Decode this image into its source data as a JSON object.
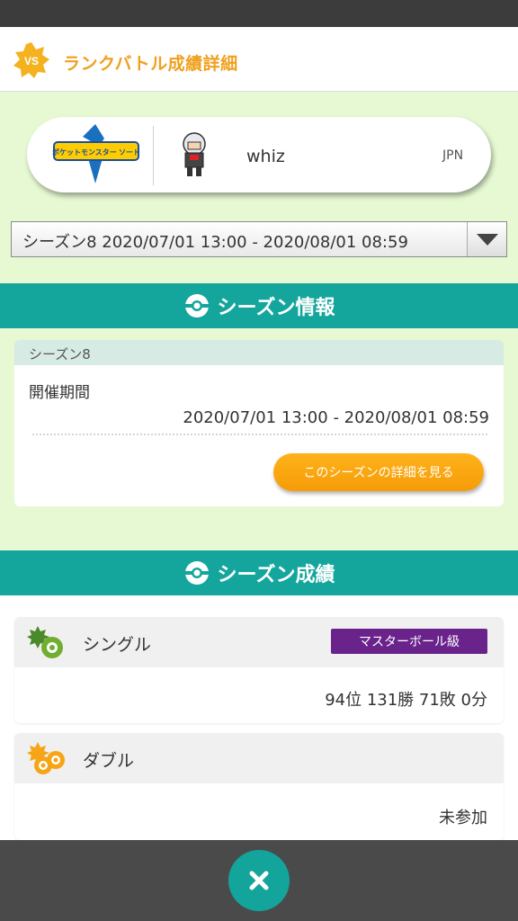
{
  "header": {
    "badge": "VS",
    "title": "ランクバトル成績詳細"
  },
  "profile": {
    "game_logo_text": "ポケットモンスター ソード",
    "name": "whiz",
    "region": "JPN"
  },
  "season_select": {
    "selected": "シーズン8 2020/07/01 13:00 - 2020/08/01 08:59"
  },
  "season_info": {
    "banner_title": "シーズン情報",
    "season_name": "シーズン8",
    "period_label": "開催期間",
    "period_value": "2020/07/01 13:00 - 2020/08/01 08:59",
    "details_button": "このシーズンの詳細を見る"
  },
  "season_results": {
    "banner_title": "シーズン成績",
    "single": {
      "label": "シングル",
      "rank_class": "マスターボール級",
      "result": "94位 131勝 71敗 0分"
    },
    "double": {
      "label": "ダブル",
      "result": "未参加"
    }
  },
  "colors": {
    "accent_orange": "#f0a01e",
    "teal": "#14a69c",
    "master_ball_purple": "#6b238c",
    "background_green": "#e6f9d2"
  },
  "icons": [
    "vs-badge-icon",
    "close-icon",
    "battle-ball-icon",
    "single-battle-icon",
    "double-battle-icon",
    "dropdown-arrow-icon"
  ]
}
